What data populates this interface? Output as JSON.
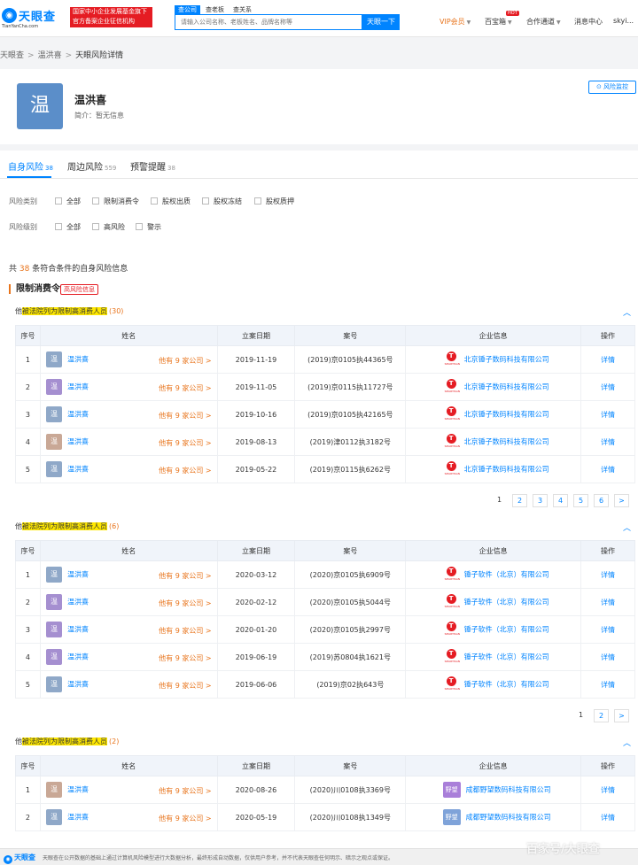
{
  "header": {
    "logo_text": "天眼查",
    "logo_sub": "TianYanCha.com",
    "banner_line1": "国家中小企业发展基金旗下",
    "banner_line2": "官方备案企业征信机构",
    "search_tabs": [
      "查公司",
      "查老板",
      "查关系"
    ],
    "search_placeholder": "请输入公司名称、老板姓名、品牌名称等",
    "search_button": "天眼一下",
    "nav": {
      "vip": "VIP会员",
      "treasure": "百宝箱",
      "hot": "HOT",
      "cooperation": "合作通道",
      "messages": "消息中心",
      "user": "skyi..."
    }
  },
  "breadcrumb": [
    "天眼查",
    "温洪喜",
    "天眼风险详情"
  ],
  "person": {
    "avatar_char": "温",
    "name": "温洪喜",
    "intro_label": "简介：",
    "intro_value": "暂无信息",
    "monitor_button": "风险监控"
  },
  "tabs": [
    {
      "label": "自身风险",
      "count": "38"
    },
    {
      "label": "周边风险",
      "count": "559"
    },
    {
      "label": "预警提醒",
      "count": "38"
    }
  ],
  "filters": {
    "category_label": "风险类别",
    "category_options": [
      "全部",
      "限制消费令",
      "股权出质",
      "股权冻结",
      "股权质押"
    ],
    "level_label": "风险级别",
    "level_options": [
      "全部",
      "高风险",
      "警示"
    ]
  },
  "summary": {
    "prefix": "共",
    "count": "38",
    "suffix": "条符合条件的自身风险信息"
  },
  "section": {
    "title": "限制消费令",
    "tag": "高风险信息"
  },
  "columns": [
    "序号",
    "姓名",
    "立案日期",
    "案号",
    "企业信息",
    "操作"
  ],
  "row_common": {
    "more_companies": "他有 9 家公司 >",
    "detail": "详情"
  },
  "groups": [
    {
      "prefix": "他",
      "highlight": "被法院列为限制高消费人员",
      "count": "(30)",
      "rows": [
        {
          "no": "1",
          "avatar": "温",
          "avatar_color": "#8fa8c8",
          "name": "温洪喜",
          "date": "2019-11-19",
          "case": "(2019)京0105执44365号",
          "company": "北京锤子数码科技有限公司"
        },
        {
          "no": "2",
          "avatar": "温",
          "avatar_color": "#a58fd0",
          "name": "温洪喜",
          "date": "2019-11-05",
          "case": "(2019)京0115执11727号",
          "company": "北京锤子数码科技有限公司"
        },
        {
          "no": "3",
          "avatar": "温",
          "avatar_color": "#8fa8c8",
          "name": "温洪喜",
          "date": "2019-10-16",
          "case": "(2019)京0105执42165号",
          "company": "北京锤子数码科技有限公司"
        },
        {
          "no": "4",
          "avatar": "温",
          "avatar_color": "#c9a896",
          "name": "温洪喜",
          "date": "2019-08-13",
          "case": "(2019)津0112执3182号",
          "company": "北京锤子数码科技有限公司"
        },
        {
          "no": "5",
          "avatar": "温",
          "avatar_color": "#8fa8c8",
          "name": "温洪喜",
          "date": "2019-05-22",
          "case": "(2019)京0115执6262号",
          "company": "北京锤子数码科技有限公司"
        }
      ],
      "pages": [
        "1",
        "2",
        "3",
        "4",
        "5",
        "6",
        ">"
      ]
    },
    {
      "prefix": "他",
      "highlight": "被法院列为限制高消费人员",
      "count": "(6)",
      "rows": [
        {
          "no": "1",
          "avatar": "温",
          "avatar_color": "#8fa8c8",
          "name": "温洪喜",
          "date": "2020-03-12",
          "case": "(2020)京0105执6909号",
          "company": "锤子软件（北京）有限公司"
        },
        {
          "no": "2",
          "avatar": "温",
          "avatar_color": "#a58fd0",
          "name": "温洪喜",
          "date": "2020-02-12",
          "case": "(2020)京0105执5044号",
          "company": "锤子软件（北京）有限公司"
        },
        {
          "no": "3",
          "avatar": "温",
          "avatar_color": "#a58fd0",
          "name": "温洪喜",
          "date": "2020-01-20",
          "case": "(2020)京0105执2997号",
          "company": "锤子软件（北京）有限公司"
        },
        {
          "no": "4",
          "avatar": "温",
          "avatar_color": "#a58fd0",
          "name": "温洪喜",
          "date": "2019-06-19",
          "case": "(2019)苏0804执1621号",
          "company": "锤子软件（北京）有限公司"
        },
        {
          "no": "5",
          "avatar": "温",
          "avatar_color": "#8fa8c8",
          "name": "温洪喜",
          "date": "2019-06-06",
          "case": "(2019)京02执643号",
          "company": "锤子软件（北京）有限公司"
        }
      ],
      "pages": [
        "1",
        "2",
        ">"
      ]
    },
    {
      "prefix": "他",
      "highlight": "被法院列为限制高消费人员",
      "count": "(2)",
      "rows": [
        {
          "no": "1",
          "avatar": "温",
          "avatar_color": "#c9a896",
          "name": "温洪喜",
          "date": "2020-08-26",
          "case": "(2020)川0108执3369号",
          "company": "成都野望数码科技有限公司",
          "logo_text": "野望",
          "logo_color": "#a97fd9"
        },
        {
          "no": "2",
          "avatar": "温",
          "avatar_color": "#8fa8c8",
          "name": "温洪喜",
          "date": "2020-05-19",
          "case": "(2020)川0108执1349号",
          "company": "成都野望数码科技有限公司",
          "logo_text": "野望",
          "logo_color": "#7fa3d9"
        }
      ],
      "pages": []
    }
  ],
  "company_logo_text": "SMARTISAN",
  "footer": {
    "logo": "天眼查",
    "text": "天眼查在公开数据的基础上通过计算机风险模型进行大数据分析，最终形成自动数据，仅供用户参考，并不代表天眼查任何明示、暗示之观点或保证。"
  },
  "watermark": "百家号/大眼查"
}
